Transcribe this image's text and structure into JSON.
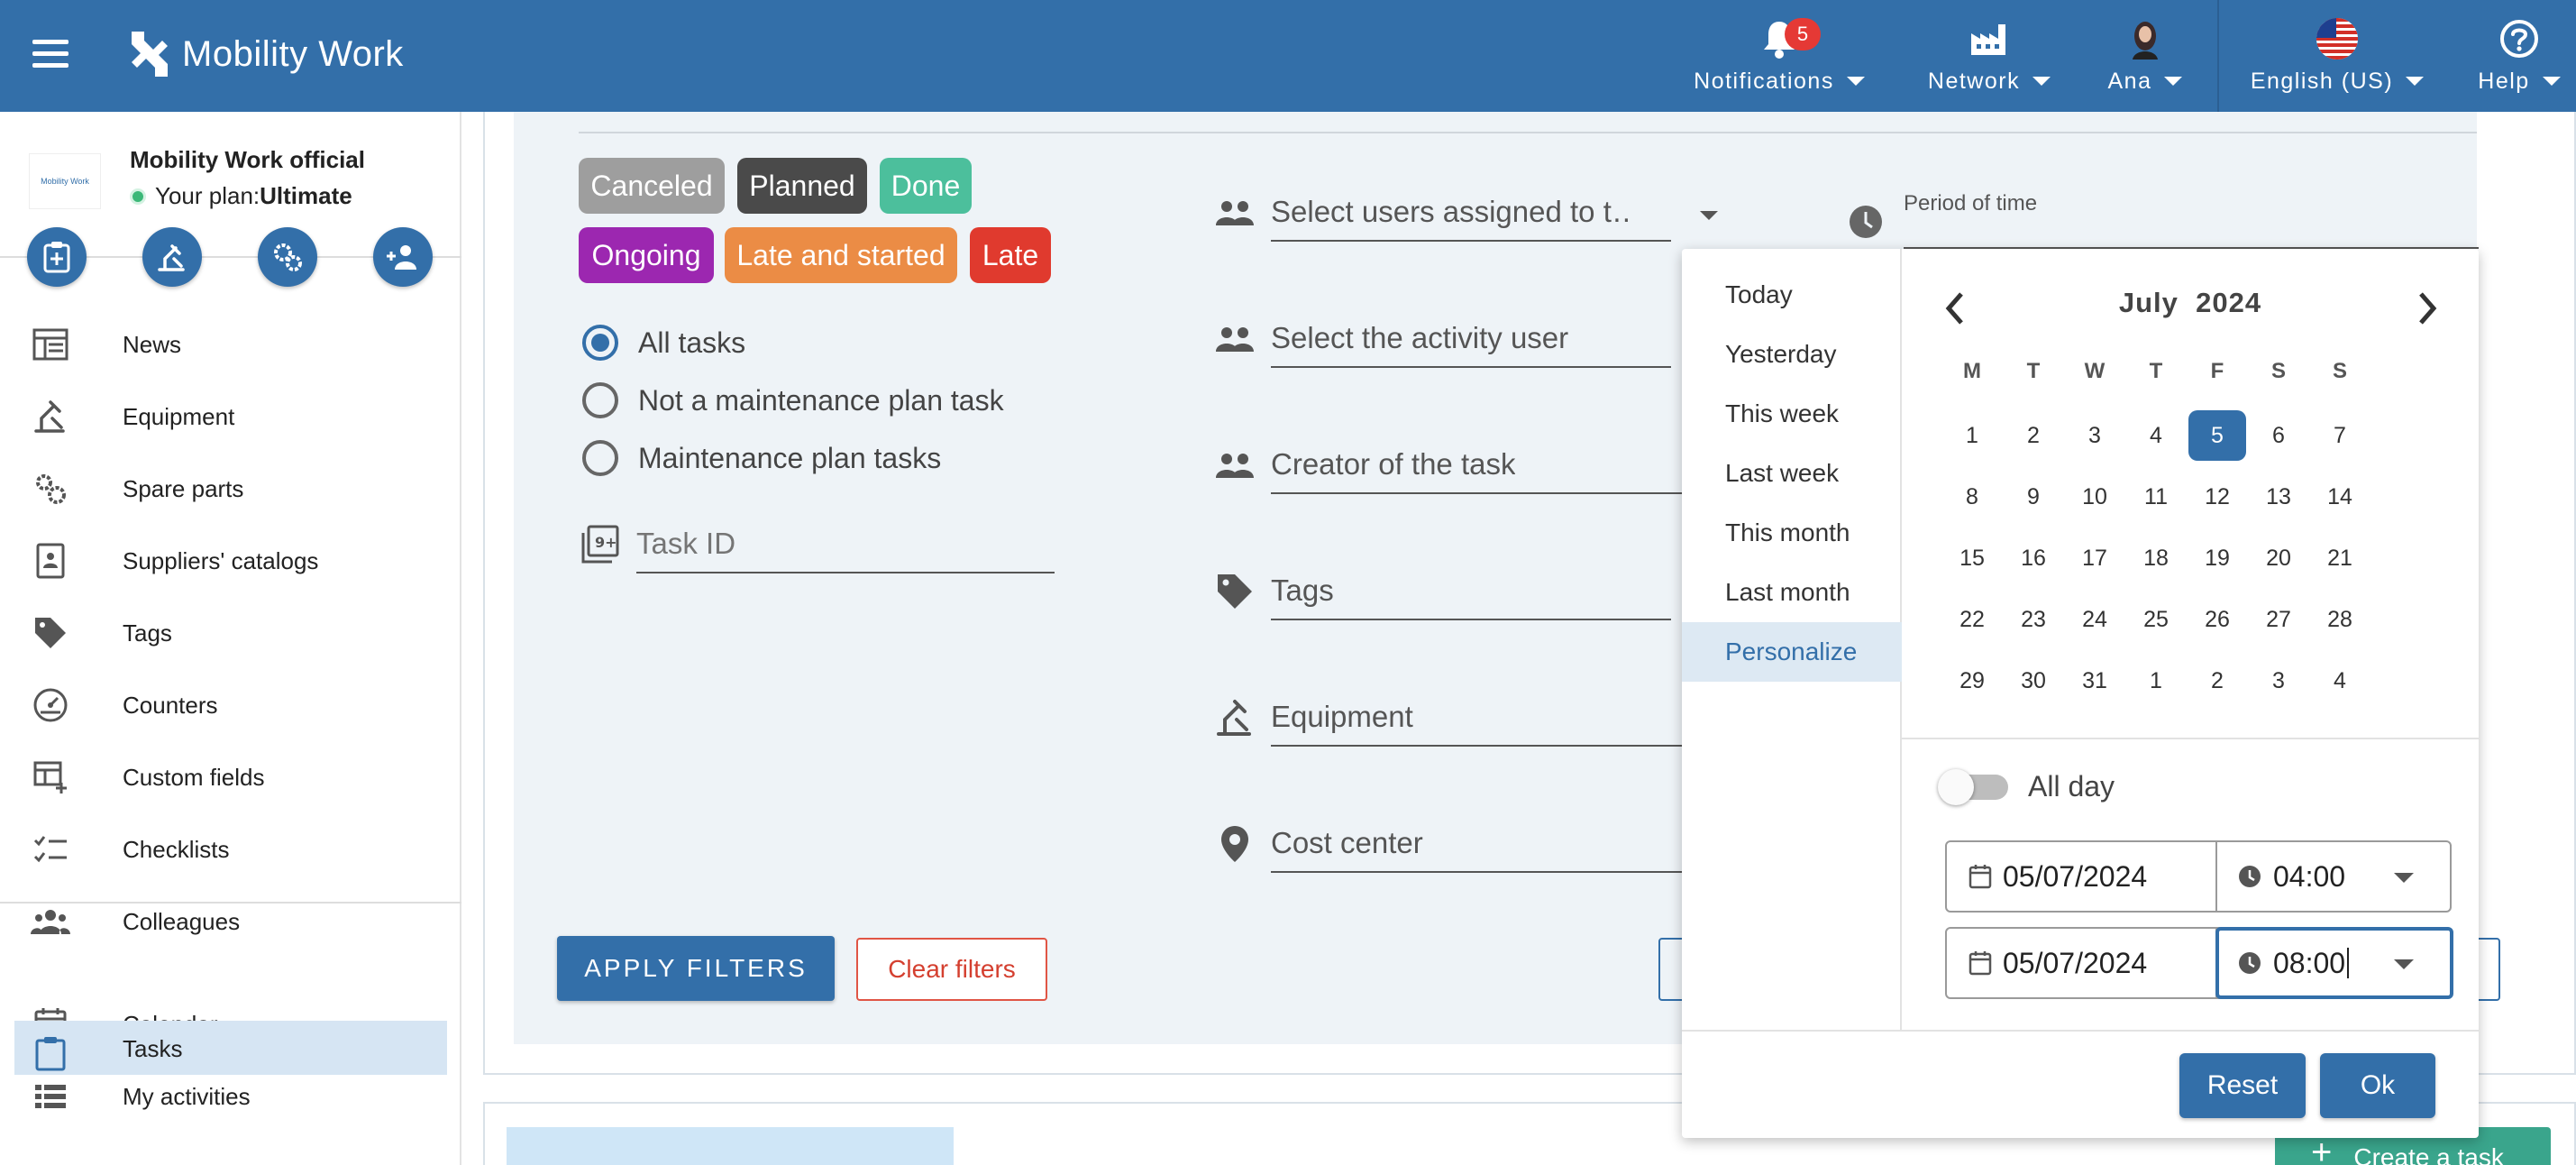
{
  "header": {
    "app_name": "Mobility Work",
    "notifications": {
      "label": "Notifications",
      "count": "5"
    },
    "network": {
      "label": "Network"
    },
    "user": {
      "label": "Ana"
    },
    "language": {
      "label": "English (US)"
    },
    "help": {
      "label": "Help"
    }
  },
  "sidebar": {
    "org_name": "Mobility Work official",
    "plan_prefix": "Your plan:",
    "plan_name": "Ultimate",
    "org_logo_text": "Mobility Work",
    "items": [
      {
        "label": "News",
        "icon": "news-icon"
      },
      {
        "label": "Equipment",
        "icon": "equipment-icon"
      },
      {
        "label": "Spare parts",
        "icon": "spare-parts-icon"
      },
      {
        "label": "Suppliers' catalogs",
        "icon": "catalog-icon"
      },
      {
        "label": "Tags",
        "icon": "tag-icon"
      },
      {
        "label": "Counters",
        "icon": "gauge-icon"
      },
      {
        "label": "Custom fields",
        "icon": "custom-fields-icon"
      },
      {
        "label": "Checklists",
        "icon": "checklist-icon"
      },
      {
        "label": "Colleagues",
        "icon": "people-icon"
      },
      {
        "label": "Calendar",
        "icon": "calendar-icon"
      },
      {
        "label": "My activities",
        "icon": "list-icon"
      },
      {
        "label": "Tasks",
        "icon": "tasks-icon"
      }
    ]
  },
  "filters": {
    "statuses": [
      {
        "label": "Canceled",
        "color": "#9e9e9e"
      },
      {
        "label": "Planned",
        "color": "#4a4a4a"
      },
      {
        "label": "Done",
        "color": "#4cbf9c"
      },
      {
        "label": "Ongoing",
        "color": "#9c27b0"
      },
      {
        "label": "Late and started",
        "color": "#eb8c45"
      },
      {
        "label": "Late",
        "color": "#e03a2e"
      }
    ],
    "task_type": {
      "options": [
        "All tasks",
        "Not a maintenance plan task",
        "Maintenance plan tasks"
      ],
      "selected": "All tasks"
    },
    "task_id_placeholder": "Task ID",
    "assigned_users": "Select users assigned to t…",
    "activity_user": "Select the activity user",
    "creator": "Creator of the task",
    "tags": "Tags",
    "equipment": "Equipment",
    "cost_center": "Cost center",
    "period_label": "Period of time",
    "apply_label": "APPLY FILTERS",
    "clear_label": "Clear filters"
  },
  "date_picker": {
    "presets": [
      "Today",
      "Yesterday",
      "This week",
      "Last week",
      "This month",
      "Last month",
      "Personalize"
    ],
    "active_preset": "Personalize",
    "month": "July",
    "year": "2024",
    "weekdays": [
      "M",
      "T",
      "W",
      "T",
      "F",
      "S",
      "S"
    ],
    "weeks": [
      [
        "1",
        "2",
        "3",
        "4",
        "5",
        "6",
        "7"
      ],
      [
        "8",
        "9",
        "10",
        "11",
        "12",
        "13",
        "14"
      ],
      [
        "15",
        "16",
        "17",
        "18",
        "19",
        "20",
        "21"
      ],
      [
        "22",
        "23",
        "24",
        "25",
        "26",
        "27",
        "28"
      ],
      [
        "29",
        "30",
        "31",
        "1",
        "2",
        "3",
        "4"
      ]
    ],
    "selected_day": "5",
    "all_day_label": "All day",
    "all_day": false,
    "start": {
      "date": "05/07/2024",
      "time": "04:00"
    },
    "end": {
      "date": "05/07/2024",
      "time": "08:00"
    },
    "reset_label": "Reset",
    "ok_label": "Ok"
  },
  "bottom": {
    "create_label": "Create a task"
  },
  "colors": {
    "primary": "#336fa9",
    "accent_green": "#3aa58c"
  }
}
